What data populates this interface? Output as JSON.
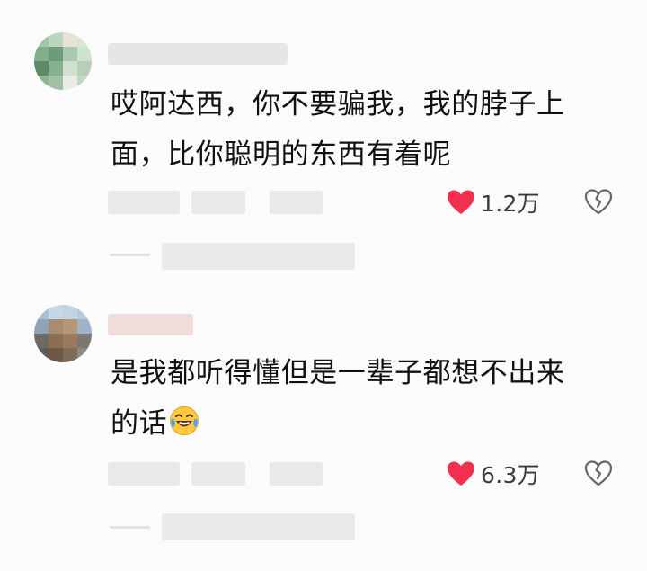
{
  "comments": [
    {
      "text_line1": "哎阿达西，你不要骗我，我的脖子上",
      "text_line2": "面，比你聪明的东西有着呢",
      "likes": "1.2万",
      "like_icon": "heart-filled-icon",
      "dislike_icon": "broken-heart-icon"
    },
    {
      "text_line1": "是我都听得懂但是一辈子都想不出来",
      "text_line2": "的话",
      "emoji": "laughing-crying-emoji",
      "likes": "6.3万",
      "like_icon": "heart-filled-icon",
      "dislike_icon": "broken-heart-icon"
    }
  ],
  "colors": {
    "like_red": "#f0304e",
    "text": "#111111",
    "meta_gray": "#3b3b3b",
    "background": "#fbfbfb"
  }
}
